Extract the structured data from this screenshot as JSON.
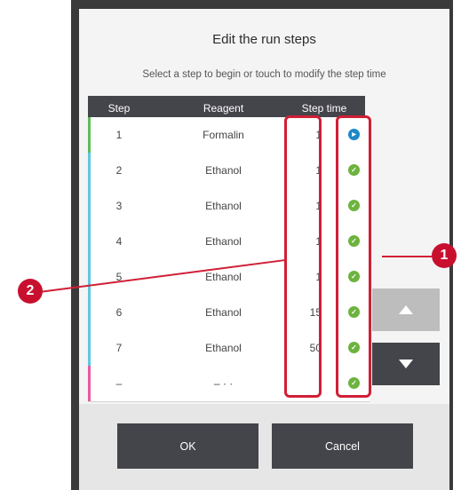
{
  "dialog": {
    "title": "Edit the run steps",
    "subtitle": "Select a step to begin or touch to modify the step time"
  },
  "table": {
    "headers": {
      "step": "Step",
      "reagent": "Reagent",
      "step_time": "Step time"
    },
    "rows": [
      {
        "step": "1",
        "reagent": "Formalin",
        "time": "1",
        "status": "current",
        "stripe": "#5dbb5b"
      },
      {
        "step": "2",
        "reagent": "Ethanol",
        "time": "1",
        "status": "ok",
        "stripe": "#5cc8e0"
      },
      {
        "step": "3",
        "reagent": "Ethanol",
        "time": "1",
        "status": "ok",
        "stripe": "#5cc8e0"
      },
      {
        "step": "4",
        "reagent": "Ethanol",
        "time": "1",
        "status": "ok",
        "stripe": "#5cc8e0"
      },
      {
        "step": "5",
        "reagent": "Ethanol",
        "time": "1",
        "status": "ok",
        "stripe": "#5cc8e0"
      },
      {
        "step": "6",
        "reagent": "Ethanol",
        "time": "15",
        "status": "ok",
        "stripe": "#5cc8e0"
      },
      {
        "step": "7",
        "reagent": "Ethanol",
        "time": "50",
        "status": "ok",
        "stripe": "#5cc8e0"
      },
      {
        "step": "–",
        "reagent": "– · ·",
        "time": "·",
        "status": "ok",
        "stripe": "#e85aa0"
      }
    ]
  },
  "buttons": {
    "ok": "OK",
    "cancel": "Cancel"
  },
  "callouts": {
    "one": "1",
    "two": "2"
  },
  "icons": {
    "up": "arrow-up-icon",
    "down": "arrow-down-icon",
    "current": "play-icon",
    "ok": "check-icon"
  },
  "colors": {
    "accent_red": "#d01f36",
    "status_ok": "#6db33f",
    "status_current": "#1e88c8",
    "button_dark": "#44444b"
  }
}
